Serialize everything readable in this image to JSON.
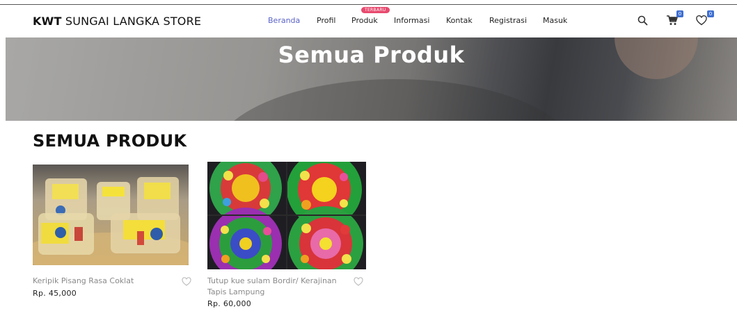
{
  "brand": {
    "bold": "KWT",
    "rest": "SUNGAI LANGKA STORE"
  },
  "nav": {
    "items": [
      {
        "label": "Beranda",
        "active": true
      },
      {
        "label": "Profil"
      },
      {
        "label": "Produk"
      },
      {
        "label": "Informasi"
      },
      {
        "label": "Kontak"
      },
      {
        "label": "Registrasi"
      },
      {
        "label": "Masuk"
      }
    ],
    "badge": "TERBARU"
  },
  "header_icons": {
    "search": "search-icon",
    "cart": {
      "icon": "cart-icon",
      "count": "0"
    },
    "wishlist": {
      "icon": "heart-icon",
      "count": "0"
    }
  },
  "hero": {
    "title": "Semua Produk"
  },
  "section": {
    "title": "SEMUA PRODUK"
  },
  "products": [
    {
      "name": "Keripik Pisang Rasa Coklat",
      "price": "Rp. 45,000"
    },
    {
      "name": "Tutup kue sulam Bordir/ Kerajinan Tapis Lampung",
      "price": "Rp. 60,000"
    }
  ],
  "colors": {
    "accent": "#5b63c7",
    "badge": "#e84a6e",
    "count_badge": "#3f6fd1"
  }
}
